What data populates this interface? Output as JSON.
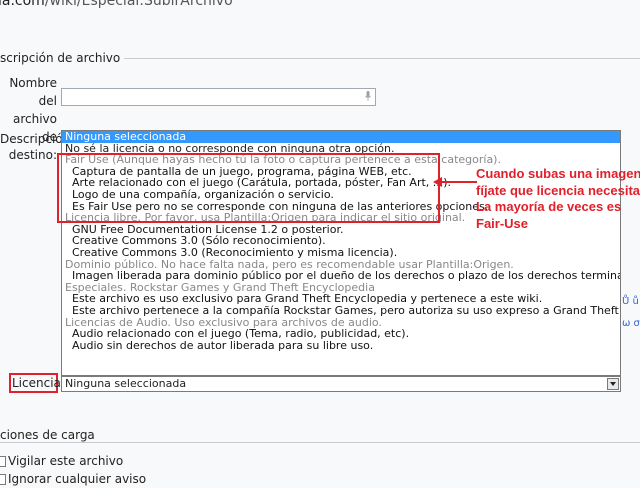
{
  "url": {
    "host_fragment": "ia.com",
    "path": "/wiki/Especial:SubirArchivo"
  },
  "sections": {
    "file_description": "scripción de archivo",
    "upload_options": "ciones de carga"
  },
  "labels": {
    "dest_name_line1": "Nombre del",
    "dest_name_line2": "archivo de",
    "dest_name_line3": "destino:",
    "description": "Descripción:",
    "license": "Licencia:"
  },
  "license_options": [
    {
      "text": "Ninguna seleccionada",
      "kind": "selected"
    },
    {
      "text": "No sé la licencia o no corresponde con ninguna otra opción.",
      "kind": "item"
    },
    {
      "text": "Fair Use (Aunque hayas hecho tú la foto o captura pertenece a esta categoría).",
      "kind": "group"
    },
    {
      "text": "Captura de pantalla de un juego, programa, página WEB, etc.",
      "kind": "sub"
    },
    {
      "text": "Arte relacionado con el juego (Carátula, portada, póster, Fan Art, ...).",
      "kind": "sub"
    },
    {
      "text": "Logo de una compañía, organización o servicio.",
      "kind": "sub"
    },
    {
      "text": "Es Fair Use pero no se corresponde con ninguna de las anteriores opciones.",
      "kind": "sub"
    },
    {
      "text": "Licencia libre. Por favor, usa Plantilla:Origen para indicar el sitio original.",
      "kind": "group"
    },
    {
      "text": "GNU Free Documentation License 1.2 o posterior.",
      "kind": "sub"
    },
    {
      "text": "Creative Commons 3.0 (Sólo reconocimiento).",
      "kind": "sub"
    },
    {
      "text": "Creative Commons 3.0 (Reconocimiento y misma licencia).",
      "kind": "sub"
    },
    {
      "text": "Dominio público. No hace falta nada, pero es recomendable usar Plantilla:Origen.",
      "kind": "group"
    },
    {
      "text": "Imagen liberada para dominio público por el dueño de los derechos o plazo de los derechos terminado.",
      "kind": "sub"
    },
    {
      "text": "Especiales. Rockstar Games y Grand Theft Encyclopedia",
      "kind": "group"
    },
    {
      "text": "Este archivo es uso exclusivo para Grand Theft Encyclopedia y pertenece a este wiki.",
      "kind": "sub"
    },
    {
      "text": "Este archivo pertenece a la compañía Rockstar Games, pero autoriza su uso expreso a Grand Theft Encyclopedia.",
      "kind": "sub"
    },
    {
      "text": "Licencias de Audio. Uso exclusivo para archivos de audio.",
      "kind": "group"
    },
    {
      "text": "Audio relacionado con el juego (Tema, radio, publicidad, etc).",
      "kind": "sub"
    },
    {
      "text": "Audio sin derechos de autor liberada para su libre uso.",
      "kind": "sub"
    }
  ],
  "license_select": {
    "value": "Ninguna seleccionada"
  },
  "annotation": {
    "line1": "Cuando subas una imagen",
    "line2": "fíjate que licencia necesita.",
    "line3": "La mayoría de veces es",
    "line4": "Fair-Use",
    "color": "#e0202a"
  },
  "side_symbols": {
    "row1": "Ů ů ·",
    "row2": "ω σ ( "
  },
  "checkboxes": {
    "watch": "Vigilar este archivo",
    "ignore": "Ignorar cualquier aviso"
  },
  "colors": {
    "selected_bg": "#3399ff",
    "group_text": "#888888",
    "highlight": "#e0202a"
  }
}
